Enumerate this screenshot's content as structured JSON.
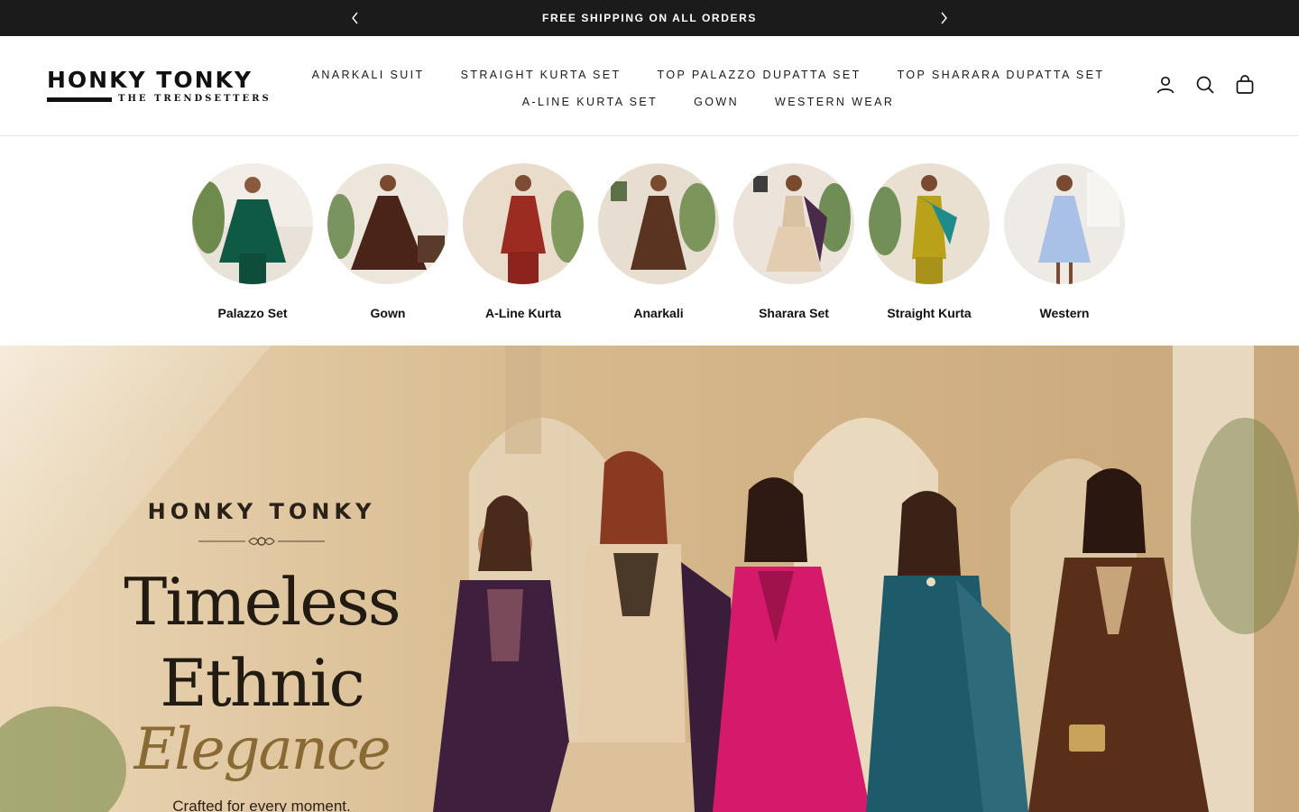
{
  "announcement": {
    "text": "FREE SHIPPING ON ALL ORDERS",
    "prev_icon": "chevron-left-icon",
    "next_icon": "chevron-right-icon"
  },
  "header": {
    "logo": {
      "name": "HONKY TONKY",
      "tagline": "THE TRENDSETTERS"
    },
    "nav_row1": [
      "ANARKALI SUIT",
      "STRAIGHT KURTA SET",
      "TOP PALAZZO DUPATTA SET",
      "TOP SHARARA DUPATTA SET"
    ],
    "nav_row2": [
      "A-LINE KURTA SET",
      "GOWN",
      "WESTERN WEAR"
    ],
    "icons": [
      "account-icon",
      "search-icon",
      "cart-icon"
    ]
  },
  "categories": [
    {
      "label": "Palazzo Set",
      "color": "#0f5a44"
    },
    {
      "label": "Gown",
      "color": "#4a2418"
    },
    {
      "label": "A-Line Kurta",
      "color": "#9c2b22"
    },
    {
      "label": "Anarkali",
      "color": "#5a3420"
    },
    {
      "label": "Sharara Set",
      "color": "#d9c2a3"
    },
    {
      "label": "Straight Kurta",
      "color": "#b9a21a"
    },
    {
      "label": "Western",
      "color": "#a9c1e6"
    }
  ],
  "hero": {
    "brand": "HONKY TONKY",
    "headline1": "Timeless",
    "headline2": "Ethnic",
    "headline3": "Elegance",
    "subtext": "Crafted for every moment."
  }
}
